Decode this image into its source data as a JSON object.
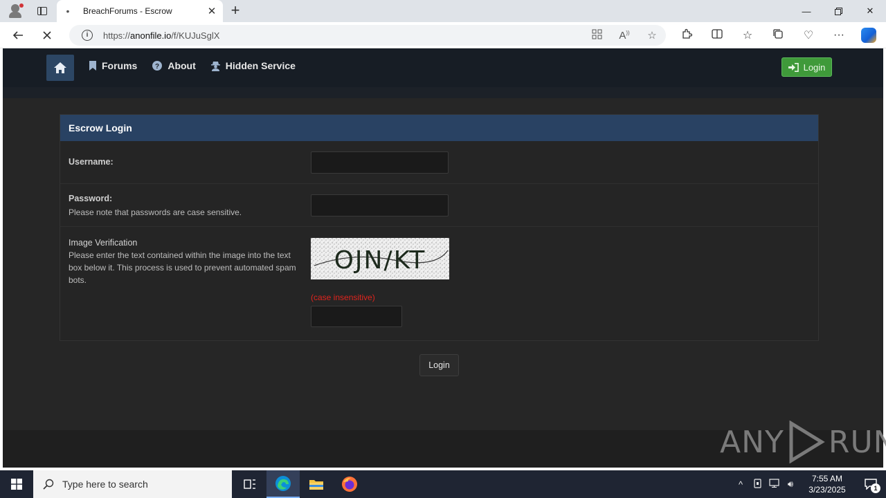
{
  "browser": {
    "tab_title": "BreachForums - Escrow",
    "tab_favicon": "•",
    "url_prefix": "https://",
    "url_domain": "anonfile.io",
    "url_path": "/f/KUJuSglX"
  },
  "site_nav": {
    "items": [
      {
        "label": "Forums",
        "icon": "bookmark-icon"
      },
      {
        "label": "About",
        "icon": "question-circle-icon"
      },
      {
        "label": "Hidden Service",
        "icon": "user-secret-icon"
      }
    ],
    "login_label": "Login",
    "login_color": "#3f9a3a",
    "header_color": "#171d25",
    "home_btn_color": "#2c4664"
  },
  "form": {
    "title": "Escrow Login",
    "username_label": "Username:",
    "password_label": "Password:",
    "password_desc": "Please note that passwords are case sensitive.",
    "verify_label": "Image Verification",
    "verify_desc": "Please enter the text contained within the image into the text box below it. This process is used to prevent automated spam bots.",
    "captcha_text": "OJN/KT",
    "case_note": "(case insensitive)",
    "submit_label": "Login"
  },
  "watermark": {
    "left": "ANY",
    "right": "RUN"
  },
  "taskbar": {
    "search_placeholder": "Type here to search",
    "time": "7:55 AM",
    "date": "3/23/2025",
    "notification_count": "1"
  }
}
